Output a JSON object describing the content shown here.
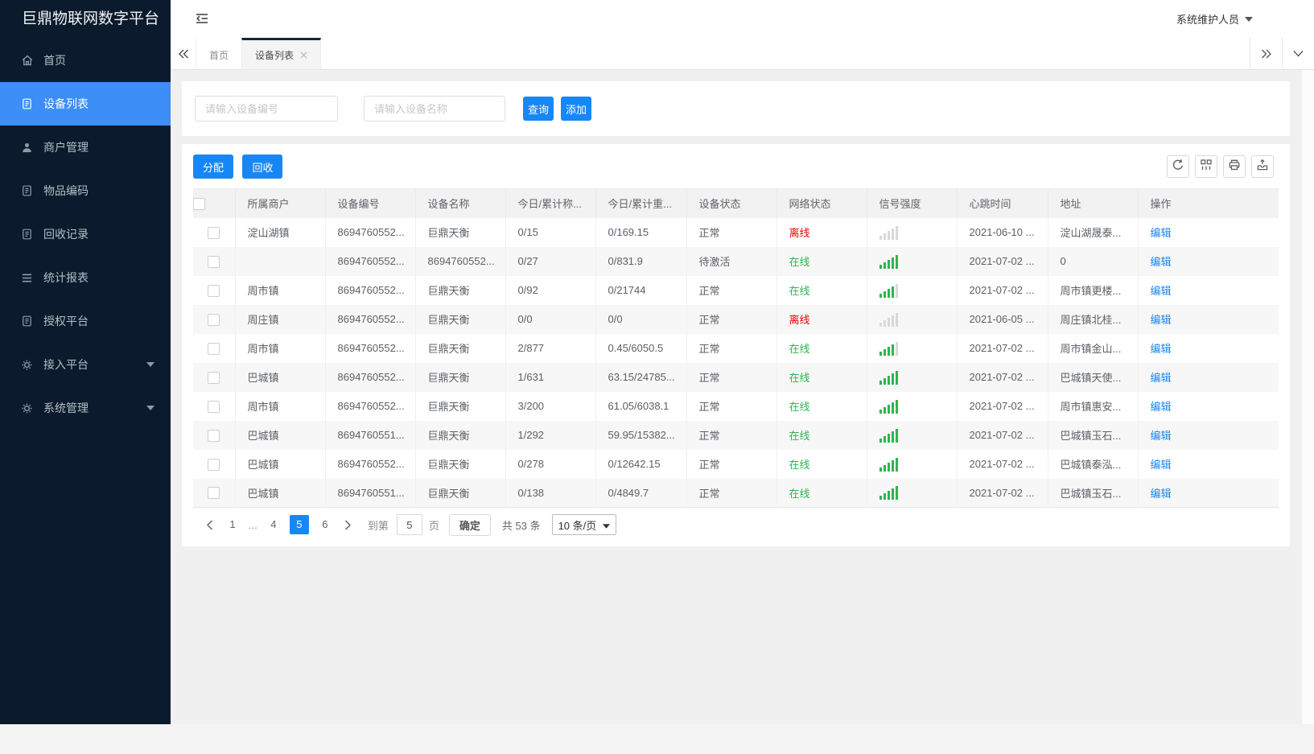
{
  "brand": "巨鼎物联网数字平台",
  "user": {
    "name": "系统维护人员"
  },
  "sidebar": {
    "items": [
      {
        "id": "home",
        "label": "首页",
        "icon": "home",
        "active": false,
        "expandable": false
      },
      {
        "id": "device-list",
        "label": "设备列表",
        "icon": "docform",
        "active": true,
        "expandable": false
      },
      {
        "id": "merchant-management",
        "label": "商户管理",
        "icon": "user",
        "active": false,
        "expandable": false
      },
      {
        "id": "item-coding",
        "label": "物品编码",
        "icon": "docform",
        "active": false,
        "expandable": false
      },
      {
        "id": "recycle-records",
        "label": "回收记录",
        "icon": "docform",
        "active": false,
        "expandable": false
      },
      {
        "id": "statistics-report",
        "label": "统计报表",
        "icon": "lines",
        "active": false,
        "expandable": false
      },
      {
        "id": "authorization-platform",
        "label": "授权平台",
        "icon": "docform",
        "active": false,
        "expandable": false
      },
      {
        "id": "access-platform",
        "label": "接入平台",
        "icon": "gear",
        "active": false,
        "expandable": true
      },
      {
        "id": "system-management",
        "label": "系统管理",
        "icon": "gear",
        "active": false,
        "expandable": true
      }
    ]
  },
  "tabs": {
    "items": [
      {
        "id": "home",
        "label": "首页",
        "active": false,
        "closable": false
      },
      {
        "id": "device-list",
        "label": "设备列表",
        "active": true,
        "closable": true
      }
    ]
  },
  "search": {
    "device_no_placeholder": "请输入设备编号",
    "device_name_placeholder": "请输入设备名称",
    "query_label": "查询",
    "add_label": "添加"
  },
  "toolbar": {
    "allocate_label": "分配",
    "recycle_label": "回收",
    "icons": [
      {
        "id": "refresh",
        "name": "refresh-icon"
      },
      {
        "id": "columns",
        "name": "columns-icon"
      },
      {
        "id": "print",
        "name": "print-icon"
      },
      {
        "id": "export",
        "name": "export-icon"
      }
    ]
  },
  "table": {
    "columns": [
      {
        "key": "checkbox",
        "label": ""
      },
      {
        "key": "merchant",
        "label": "所属商户"
      },
      {
        "key": "device_no",
        "label": "设备编号"
      },
      {
        "key": "device_name",
        "label": "设备名称"
      },
      {
        "key": "today_count",
        "label": "今日/累计称..."
      },
      {
        "key": "today_weight",
        "label": "今日/累计重..."
      },
      {
        "key": "device_status",
        "label": "设备状态"
      },
      {
        "key": "network_status",
        "label": "网络状态"
      },
      {
        "key": "signal",
        "label": "信号强度"
      },
      {
        "key": "heartbeat",
        "label": "心跳时间"
      },
      {
        "key": "address",
        "label": "地址"
      },
      {
        "key": "action",
        "label": "操作"
      }
    ],
    "rows": [
      {
        "merchant": "淀山湖镇",
        "device_no": "8694760552...",
        "device_name": "巨鼎天衡",
        "today_count": "0/15",
        "today_weight": "0/169.15",
        "device_status": "正常",
        "network_status": "离线",
        "online": false,
        "signal": 0,
        "heartbeat": "2021-06-10 ...",
        "address": "淀山湖晟泰...",
        "action": "编辑"
      },
      {
        "merchant": "",
        "device_no": "8694760552...",
        "device_name": "8694760552...",
        "today_count": "0/27",
        "today_weight": "0/831.9",
        "device_status": "待激活",
        "network_status": "在线",
        "online": true,
        "signal": 5,
        "heartbeat": "2021-07-02 ...",
        "address": "0",
        "action": "编辑"
      },
      {
        "merchant": "周市镇",
        "device_no": "8694760552...",
        "device_name": "巨鼎天衡",
        "today_count": "0/92",
        "today_weight": "0/21744",
        "device_status": "正常",
        "network_status": "在线",
        "online": true,
        "signal": 4,
        "heartbeat": "2021-07-02 ...",
        "address": "周市镇更楼...",
        "action": "编辑"
      },
      {
        "merchant": "周庄镇",
        "device_no": "8694760552...",
        "device_name": "巨鼎天衡",
        "today_count": "0/0",
        "today_weight": "0/0",
        "device_status": "正常",
        "network_status": "离线",
        "online": false,
        "signal": 0,
        "heartbeat": "2021-06-05 ...",
        "address": "周庄镇北桂...",
        "action": "编辑"
      },
      {
        "merchant": "周市镇",
        "device_no": "8694760552...",
        "device_name": "巨鼎天衡",
        "today_count": "2/877",
        "today_weight": "0.45/6050.5",
        "device_status": "正常",
        "network_status": "在线",
        "online": true,
        "signal": 4,
        "heartbeat": "2021-07-02 ...",
        "address": "周市镇金山...",
        "action": "编辑"
      },
      {
        "merchant": "巴城镇",
        "device_no": "8694760552...",
        "device_name": "巨鼎天衡",
        "today_count": "1/631",
        "today_weight": "63.15/24785...",
        "device_status": "正常",
        "network_status": "在线",
        "online": true,
        "signal": 5,
        "heartbeat": "2021-07-02 ...",
        "address": "巴城镇天使...",
        "action": "编辑"
      },
      {
        "merchant": "周市镇",
        "device_no": "8694760552...",
        "device_name": "巨鼎天衡",
        "today_count": "3/200",
        "today_weight": "61.05/6038.1",
        "device_status": "正常",
        "network_status": "在线",
        "online": true,
        "signal": 5,
        "heartbeat": "2021-07-02 ...",
        "address": "周市镇惠安...",
        "action": "编辑"
      },
      {
        "merchant": "巴城镇",
        "device_no": "8694760551...",
        "device_name": "巨鼎天衡",
        "today_count": "1/292",
        "today_weight": "59.95/15382...",
        "device_status": "正常",
        "network_status": "在线",
        "online": true,
        "signal": 5,
        "heartbeat": "2021-07-02 ...",
        "address": "巴城镇玉石...",
        "action": "编辑"
      },
      {
        "merchant": "巴城镇",
        "device_no": "8694760552...",
        "device_name": "巨鼎天衡",
        "today_count": "0/278",
        "today_weight": "0/12642.15",
        "device_status": "正常",
        "network_status": "在线",
        "online": true,
        "signal": 5,
        "heartbeat": "2021-07-02 ...",
        "address": "巴城镇泰泓...",
        "action": "编辑"
      },
      {
        "merchant": "巴城镇",
        "device_no": "8694760551...",
        "device_name": "巨鼎天衡",
        "today_count": "0/138",
        "today_weight": "0/4849.7",
        "device_status": "正常",
        "network_status": "在线",
        "online": true,
        "signal": 5,
        "heartbeat": "2021-07-02 ...",
        "address": "巴城镇玉石...",
        "action": "编辑"
      }
    ]
  },
  "pagination": {
    "pages": [
      "1",
      "...",
      "4",
      "5",
      "6"
    ],
    "active": "5",
    "goto_label": "到第",
    "goto_value": "5",
    "page_label": "页",
    "confirm_label": "确定",
    "total_label": "共 53 条",
    "page_size": "10 条/页"
  },
  "colors": {
    "accent": "#1787f5",
    "sidebar_bg": "#0b1b2d",
    "sidebar_active": "#3e8ef7",
    "online": "#2cb552",
    "offline": "#f20000"
  }
}
